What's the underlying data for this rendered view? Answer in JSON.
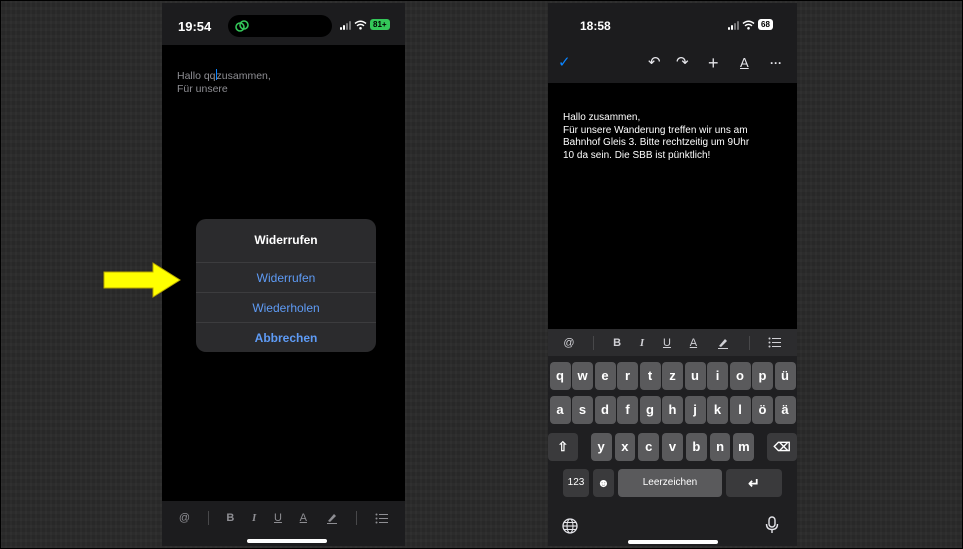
{
  "left_phone": {
    "status": {
      "time": "19:54",
      "battery": "81+"
    },
    "note_lines": [
      "Hallo qq",
      "zusammen,",
      "Für unsere"
    ],
    "dialog": {
      "title": "Widerrufen",
      "buttons": [
        "Widerrufen",
        "Wiederholen",
        "Abbrechen"
      ]
    },
    "format_bar": [
      "@",
      "B",
      "I",
      "U",
      "A"
    ]
  },
  "arrow": {
    "color": "#ffff00"
  },
  "right_phone": {
    "status": {
      "time": "18:58",
      "battery": "68"
    },
    "toolbar": {
      "done": "✓",
      "undo": "↶",
      "redo": "↷",
      "add": "+",
      "text": "A",
      "more": "···"
    },
    "document_lines": [
      "Hallo zusammen,",
      "Für unsere Wanderung treffen wir uns am",
      "Bahnhof Gleis 3. Bitte rechtzeitig um 9Uhr",
      "10 da sein. Die SBB ist pünktlich!"
    ],
    "format_bar": [
      "@",
      "B",
      "I",
      "U",
      "A"
    ],
    "keyboard": {
      "row1": [
        "q",
        "w",
        "e",
        "r",
        "t",
        "z",
        "u",
        "i",
        "o",
        "p",
        "ü"
      ],
      "row2": [
        "a",
        "s",
        "d",
        "f",
        "g",
        "h",
        "j",
        "k",
        "l",
        "ö",
        "ä"
      ],
      "row3": [
        "y",
        "x",
        "c",
        "v",
        "b",
        "n",
        "m"
      ],
      "numbers_key": "123",
      "space_key": "Leerzeichen"
    }
  }
}
